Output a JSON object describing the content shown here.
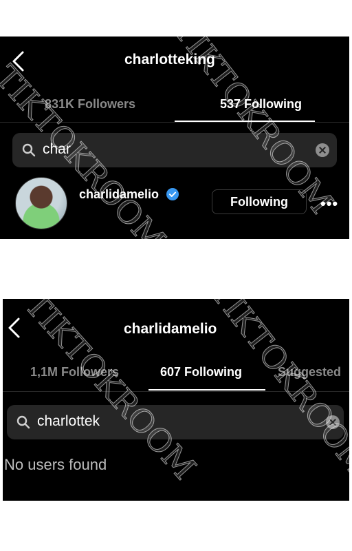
{
  "top": {
    "title": "charlotteking",
    "tabs": [
      {
        "label": "831K Followers"
      },
      {
        "label": "537 Following"
      }
    ],
    "search": {
      "value": "char"
    },
    "result": {
      "username": "charlidamelio",
      "button_label": "Following",
      "more": "•••"
    }
  },
  "bottom": {
    "title": "charlidamelio",
    "tabs": [
      {
        "label": "1,1M Followers"
      },
      {
        "label": "607 Following"
      },
      {
        "label": "Suggested"
      }
    ],
    "search": {
      "value": "charlottek"
    },
    "empty_text": "No users found"
  },
  "watermark": {
    "text": "TIKTOKROOM"
  },
  "colors": {
    "background": "#000000",
    "search_bg": "#262626",
    "verified": "#3897f0"
  }
}
